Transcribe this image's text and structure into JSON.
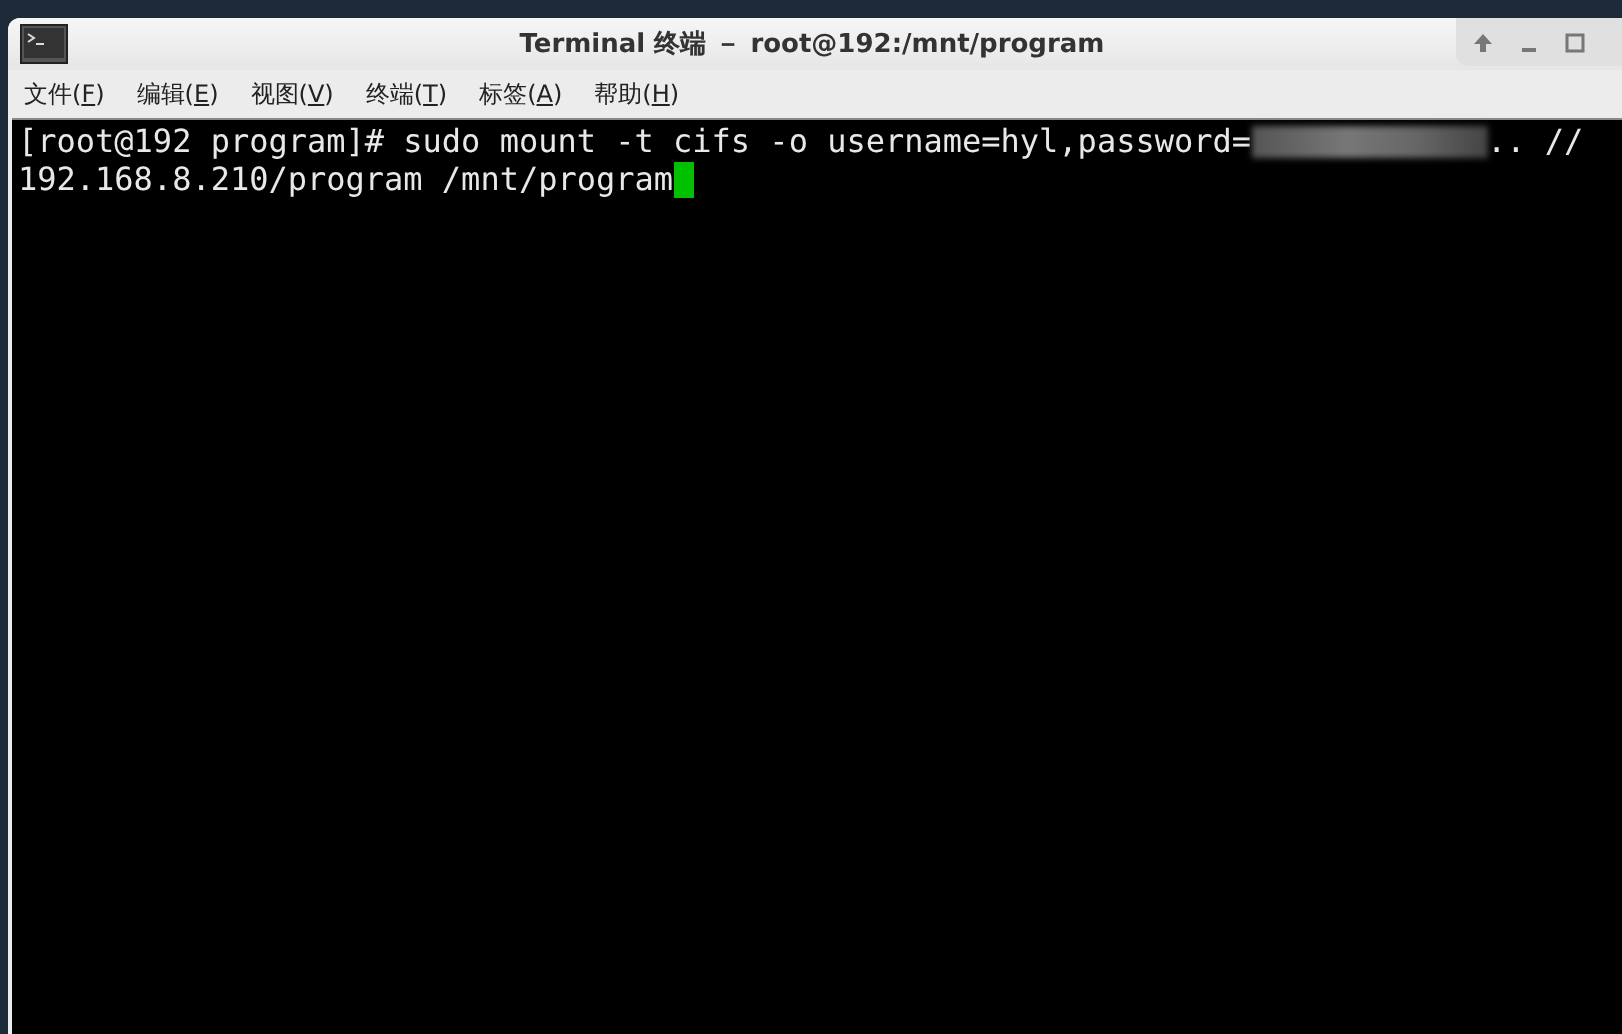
{
  "window": {
    "title": "Terminal 终端 － root@192:/mnt/program"
  },
  "menu": [
    {
      "before": "文件(",
      "key": "F",
      "after": ")"
    },
    {
      "before": "编辑(",
      "key": "E",
      "after": ")"
    },
    {
      "before": "视图(",
      "key": "V",
      "after": ")"
    },
    {
      "before": "终端(",
      "key": "T",
      "after": ")"
    },
    {
      "before": "标签(",
      "key": "A",
      "after": ")"
    },
    {
      "before": "帮助(",
      "key": "H",
      "after": ")"
    }
  ],
  "terminal": {
    "lines": [
      {
        "segments": [
          {
            "kind": "text",
            "text": "[root@192 program]# sudo mount -t cifs -o username=hyl,password="
          },
          {
            "kind": "redacted"
          },
          {
            "kind": "text",
            "text": ".. //"
          }
        ],
        "cursor": false
      },
      {
        "segments": [
          {
            "kind": "text",
            "text": "192.168.8.210/program /mnt/program"
          }
        ],
        "cursor": true
      }
    ]
  }
}
